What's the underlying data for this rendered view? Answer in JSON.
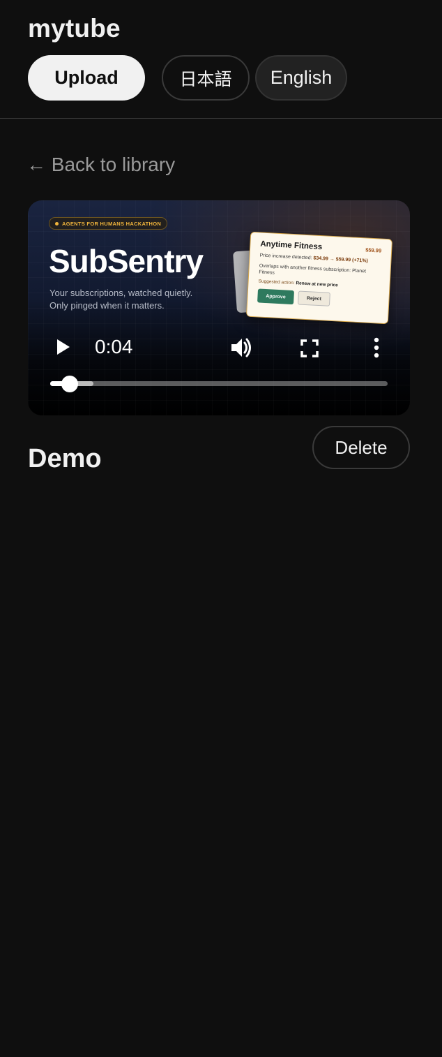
{
  "app": {
    "title": "mytube"
  },
  "header": {
    "upload_label": "Upload",
    "lang_ja_label": "日本語",
    "lang_en_label": "English"
  },
  "nav": {
    "back_label": "← Back to library"
  },
  "player": {
    "current_time": "0:04",
    "progress": 0.057,
    "buffered": 0.128,
    "frame": {
      "badge": "AGENTS FOR HUMANS HACKATHON",
      "title": "SubSentry",
      "subtitle_line1": "Your subscriptions, watched quietly.",
      "subtitle_line2": "Only pinged when it matters.",
      "card": {
        "name": "Anytime Fitness",
        "price": "$59.99",
        "line1_prefix": "Price increase detected: ",
        "line1_value": "$34.99 → $59.99 (+71%)",
        "line2": "Overlaps with another fitness subscription: Planet Fitness",
        "suggestion_prefix": "Suggested action: ",
        "suggestion_value": "Renew at new price",
        "approve_label": "Approve",
        "reject_label": "Reject"
      }
    },
    "icons": [
      "play-icon",
      "volume-icon",
      "fullscreen-icon",
      "more-vert-icon"
    ],
    "colors": {
      "badge": "#f0b43c",
      "approve": "#2e7a5e",
      "card_border": "#d8a84c"
    }
  },
  "video": {
    "title": "Demo",
    "delete_label": "Delete"
  },
  "colors": {
    "background": "#0f0f0f",
    "text": "#f1f1f1",
    "muted": "#9a9a9a",
    "upload_bg": "#f1f1f1"
  }
}
